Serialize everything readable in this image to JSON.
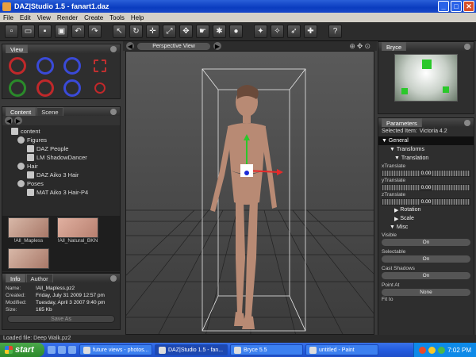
{
  "window": {
    "title": "DAZ|Studio 1.5  -  fanart1.daz",
    "controls": {
      "minimize": "_",
      "maximize": "□",
      "close": "✕"
    }
  },
  "menu": [
    "File",
    "Edit",
    "View",
    "Render",
    "Create",
    "Tools",
    "Help"
  ],
  "toolbar": {
    "icons": [
      "new-icon",
      "open-icon",
      "save-icon",
      "save-as-icon",
      "undo-icon",
      "redo-icon",
      "select-icon",
      "rotate-icon",
      "translate-icon",
      "scale-icon",
      "universal-icon",
      "node-select-icon",
      "render-icon",
      "sphere-icon",
      "spotlight-icon",
      "point-light-icon",
      "distant-light-icon",
      "camera-icon",
      "help-icon"
    ],
    "glyphs": [
      "▫",
      "▭",
      "▪",
      "▣",
      "↶",
      "↷",
      "↖",
      "↻",
      "✛",
      "⤢",
      "✥",
      "☛",
      "✱",
      "●",
      "✦",
      "✧",
      "➶",
      "✚",
      "?"
    ]
  },
  "view_panel": {
    "title": "View"
  },
  "content_panel": {
    "tabs": [
      "Content",
      "Scene"
    ],
    "tree": [
      {
        "label": "content",
        "indent": 1,
        "icon": "folder"
      },
      {
        "label": "Figures",
        "indent": 2,
        "icon": "fig"
      },
      {
        "label": "DAZ People",
        "indent": 3,
        "icon": "folder"
      },
      {
        "label": "LM ShadowDancer",
        "indent": 3,
        "icon": "folder"
      },
      {
        "label": "Hair",
        "indent": 2,
        "icon": "fig"
      },
      {
        "label": "DAZ Aiko 3 Hair",
        "indent": 3,
        "icon": "folder"
      },
      {
        "label": "Poses",
        "indent": 2,
        "icon": "fig"
      },
      {
        "label": "MAT Aiko 3 Hair-P4",
        "indent": 3,
        "icon": "folder"
      }
    ],
    "thumbs": [
      "!All_Mapless",
      "!All_Natural_BKN",
      ""
    ]
  },
  "info_panel": {
    "tabs": [
      "Info",
      "Author"
    ],
    "rows": [
      {
        "k": "Name:",
        "v": "!All_Mapless.pz2"
      },
      {
        "k": "Created:",
        "v": "Friday, July 31 2009 12:57 pm"
      },
      {
        "k": "Modified:",
        "v": "Tuesday, April 3 2007 9:40 pm"
      },
      {
        "k": "Size:",
        "v": "165 Kb"
      }
    ],
    "save_as": "Save As"
  },
  "viewport": {
    "camera_label": "Perspective View"
  },
  "bryce_panel": {
    "title": "Bryce"
  },
  "params_panel": {
    "title": "Parameters",
    "selected_label": "Selected Item:",
    "selected_value": "Victoria 4.2",
    "general": "General",
    "transforms": "Transforms",
    "translation": "Translation",
    "x_label": "xTranslate",
    "x_value": "0.00",
    "y_label": "yTranslate",
    "y_value": "0.00",
    "z_label": "zTranslate",
    "z_value": "0.00",
    "rotation": "Rotation",
    "scale": "Scale",
    "misc": "Misc",
    "visible_label": "Visible",
    "visible_value": "On",
    "selectable_label": "Selectable",
    "selectable_value": "On",
    "shadows_label": "Cast Shadows",
    "shadows_value": "On",
    "pointat_label": "Point At",
    "pointat_value": "None",
    "fitto_label": "Fit to"
  },
  "status": "Loaded file: Deep Walk.pz2",
  "taskbar": {
    "start": "start",
    "tasks": [
      {
        "label": "future views - photos...",
        "active": false
      },
      {
        "label": "DAZ|Studio 1.5 - fan...",
        "active": true
      },
      {
        "label": "Bryce 5.5",
        "active": false
      },
      {
        "label": "untitled - Paint",
        "active": false
      }
    ],
    "clock": "7:02 PM"
  }
}
